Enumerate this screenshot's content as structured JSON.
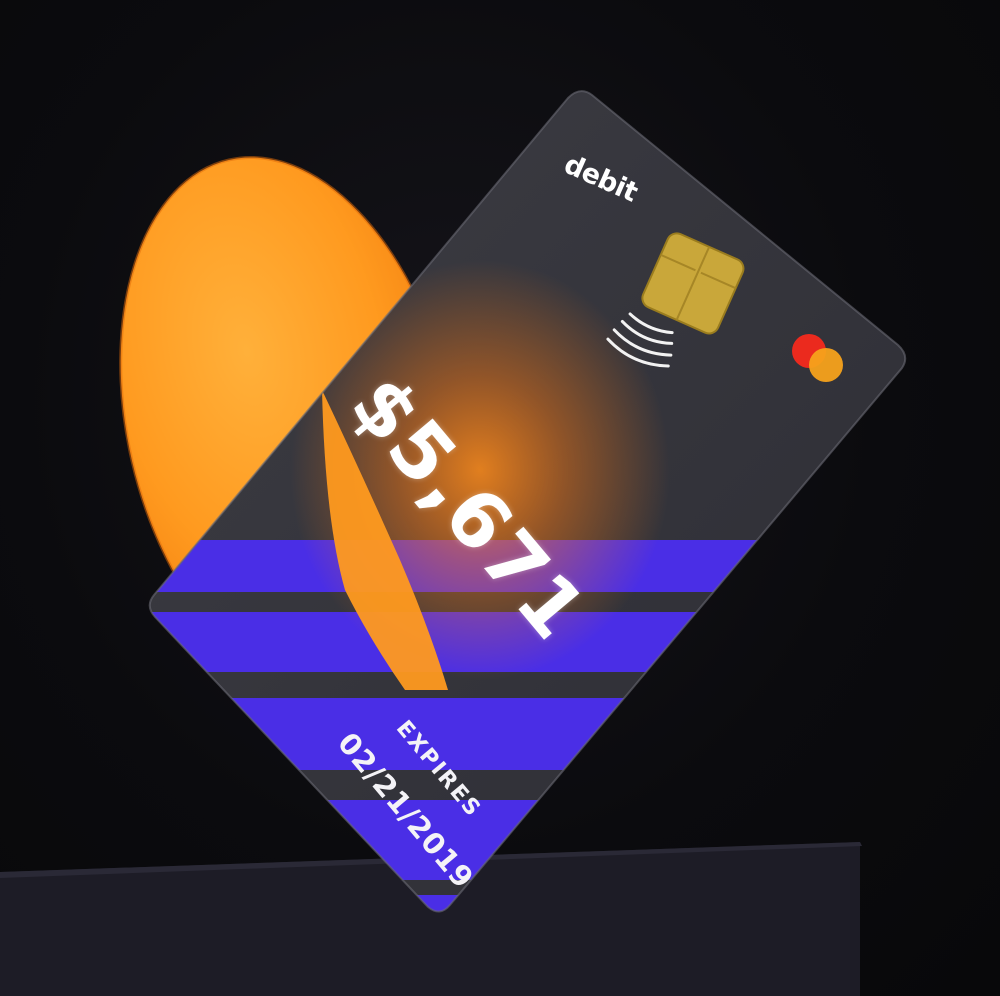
{
  "card": {
    "brand": "debit",
    "balance": "$5,671",
    "expires_label": "EXPIRES",
    "expires_date": "02/21/2019",
    "network_icon": "mastercard-logo",
    "contactless_icon": "contactless-icon",
    "chip_icon": "chip-icon"
  },
  "colors": {
    "background": "#0a0a0d",
    "card_body": "#35353b",
    "stripe": "#4a2ee6",
    "orange": "#ff9a1f",
    "chip": "#c9a73a",
    "mastercard_red": "#eb2a1e",
    "mastercard_yellow": "#f7a21b"
  }
}
